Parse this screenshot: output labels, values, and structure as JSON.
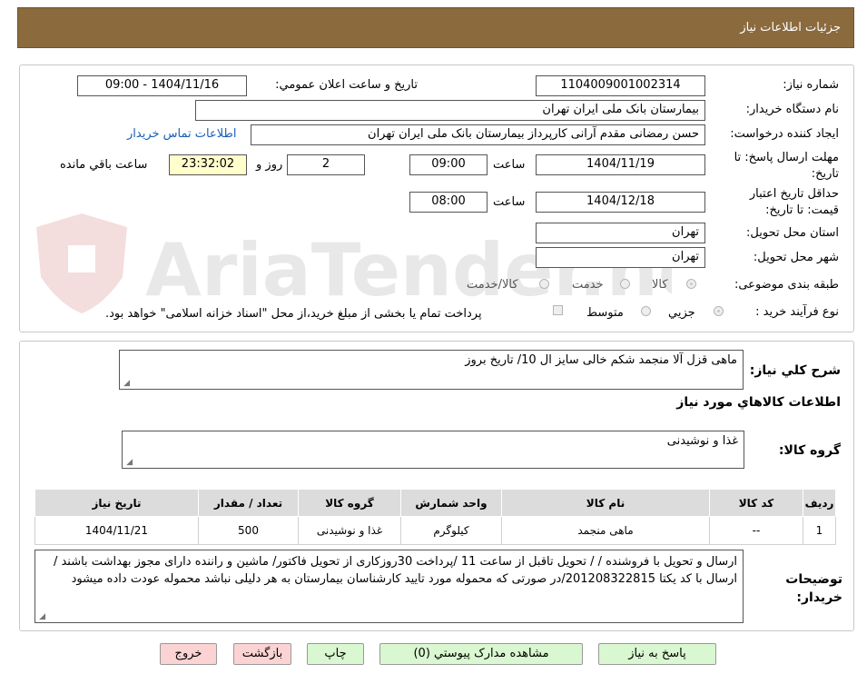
{
  "page_title": "جزئیات اطلاعات نیاز",
  "fields": {
    "need_number_label": "شماره نیاز:",
    "need_number": "1104009001002314",
    "announce_label": "تاریخ و ساعت اعلان عمومي:",
    "announce_value": "1404/11/16 - 09:00",
    "buyer_org_label": "نام دستگاه خریدار:",
    "buyer_org": "بیمارستان بانک ملی ایران تهران",
    "creator_label": "ایجاد کننده درخواست:",
    "creator": "حسن رمضانی مقدم آرانی کارپرداز بیمارستان بانک ملی ایران تهران",
    "buyer_contact_link": "اطلاعات تماس خریدار",
    "deadline_label_1": "مهلت ارسال پاسخ: تا",
    "deadline_label_2": "تاریخ:",
    "deadline_date": "1404/11/19",
    "time_label": "ساعت",
    "deadline_time": "09:00",
    "days_value": "2",
    "days_label": "روز و",
    "remaining_time": "23:32:02",
    "remaining_label": "ساعت باقي مانده",
    "validity_label_1": "حداقل تاریخ اعتبار",
    "validity_label_2": "قیمت: تا تاریخ:",
    "validity_date": "1404/12/18",
    "validity_time_label": "ساعت",
    "validity_time": "08:00",
    "province_label": "استان محل تحویل:",
    "province": "تهران",
    "city_label": "شهر محل تحویل:",
    "city": "تهران",
    "category_label": "طبقه بندی موضوعی:",
    "category_options": [
      "کالا",
      "خدمت",
      "کالا/خدمت"
    ],
    "process_label": "نوع فرآیند خرید :",
    "process_options": [
      "جزیي",
      "متوسط"
    ],
    "payment_note": "پرداخت تمام یا بخشی از مبلغ خرید،از محل \"اسناد خزانه اسلامی\" خواهد بود."
  },
  "summary": {
    "label": "شرح کلي نیاز:",
    "text": "ماهی قزل آلا منجمد شکم خالی سایز ال 10/ تاریخ بروز",
    "goods_info_title": "اطلاعات کالاهاي مورد نیاز",
    "goods_group_label": "گروه کالا:",
    "goods_group": "غذا و نوشیدنی"
  },
  "table": {
    "headers": [
      "ردیف",
      "کد کالا",
      "نام کالا",
      "واحد شمارش",
      "گروه کالا",
      "تعداد / مقدار",
      "تاریخ نیاز"
    ],
    "rows": [
      [
        "1",
        "--",
        "ماهی منجمد",
        "کیلوگرم",
        "غذا و نوشیدنی",
        "500",
        "1404/11/21"
      ]
    ]
  },
  "notes": {
    "label": "توضیحات خریدار:",
    "text": "ارسال و تحویل با فروشنده / / تحویل تاقبل از ساعت 11 /پرداخت 30روزکاری از تحویل فاکتور/ ماشین و راننده دارای مجوز بهداشت باشند / ارسال با کد یکتا 201208322815/در صورتی که محموله مورد تایید کارشناسان بیمارستان به هر دلیلی نباشد محموله عودت داده میشود"
  },
  "buttons": {
    "reply": "پاسخ به نیاز",
    "attachments": "مشاهده مدارک پیوستي (0)",
    "print": "چاپ",
    "back": "بازگشت",
    "exit": "خروج"
  },
  "watermark": "AriaTender.neT",
  "colors": {
    "header_bg": "#8b6a3e",
    "button_green": "#d9f7d0",
    "button_pink": "#fbd3d3",
    "remaining_bg": "#ffffcc",
    "link": "#1a5fb4"
  }
}
